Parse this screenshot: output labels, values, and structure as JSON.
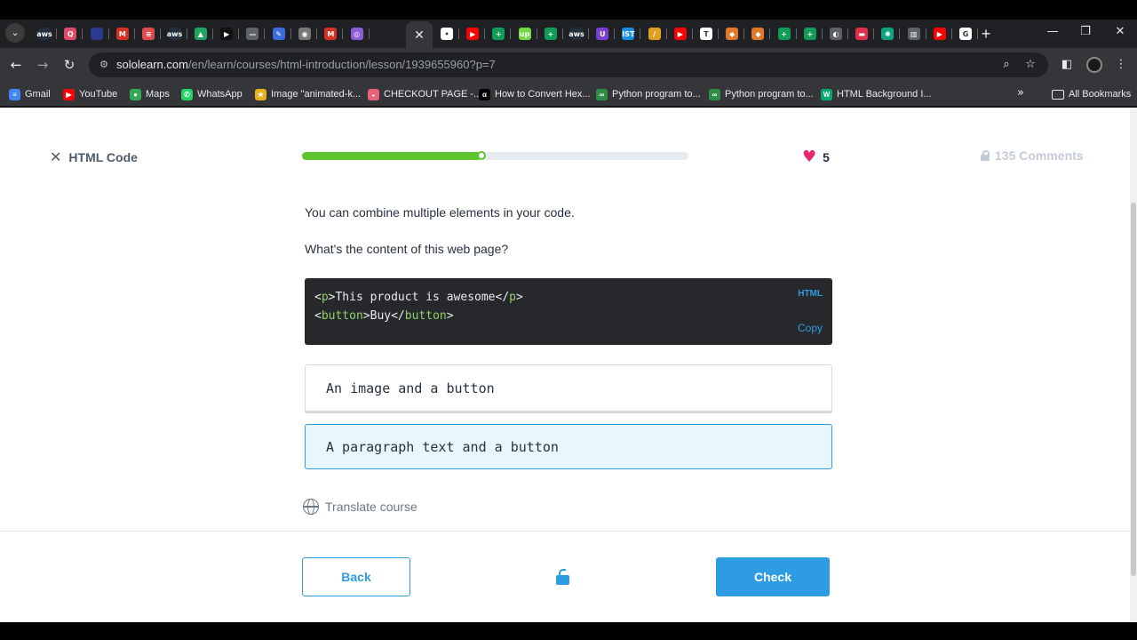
{
  "browser": {
    "url_host": "sololearn.com",
    "url_path": "/en/learn/courses/html-introduction/lesson/1939655960?p=7",
    "tabs": [
      {
        "icon": "aws-icon",
        "color": "#232f3e",
        "glyph": "aws"
      },
      {
        "icon": "q-icon",
        "color": "#e24a6a",
        "glyph": "Q"
      },
      {
        "icon": "window-icon",
        "color": "#2b3a8f",
        "glyph": ""
      },
      {
        "icon": "gmail-icon",
        "color": "#d93025",
        "glyph": "M"
      },
      {
        "icon": "news-icon",
        "color": "#e04b4b",
        "glyph": "≡"
      },
      {
        "icon": "aws-icon",
        "color": "#232f3e",
        "glyph": "aws"
      },
      {
        "icon": "drive-icon",
        "color": "#1fa463",
        "glyph": "▲"
      },
      {
        "icon": "video-icon",
        "color": "#111111",
        "glyph": "▶"
      },
      {
        "icon": "dash-icon",
        "color": "#5f6368",
        "glyph": "—"
      },
      {
        "icon": "pen-icon",
        "color": "#3c6de0",
        "glyph": "✎"
      },
      {
        "icon": "robot-icon",
        "color": "#777777",
        "glyph": "◉"
      },
      {
        "icon": "gmail-icon",
        "color": "#d93025",
        "glyph": "M"
      },
      {
        "icon": "swirl-icon",
        "color": "#8e5bd6",
        "glyph": "◎"
      }
    ],
    "tabs_right": [
      {
        "icon": "line-icon",
        "color": "#ffffff",
        "glyph": "•"
      },
      {
        "icon": "youtube-icon",
        "color": "#ff0000",
        "glyph": "▶"
      },
      {
        "icon": "sheets-icon",
        "color": "#0f9d58",
        "glyph": "+"
      },
      {
        "icon": "upwork-icon",
        "color": "#6fda44",
        "glyph": "up"
      },
      {
        "icon": "sheets-icon",
        "color": "#0f9d58",
        "glyph": "+"
      },
      {
        "icon": "aws-icon",
        "color": "#232f3e",
        "glyph": "aws"
      },
      {
        "icon": "shield-icon",
        "color": "#7a3fd0",
        "glyph": "U"
      },
      {
        "icon": "ist-icon",
        "color": "#1a8fe3",
        "glyph": "IST"
      },
      {
        "icon": "slash-icon",
        "color": "#e0a020",
        "glyph": "/"
      },
      {
        "icon": "youtube-icon",
        "color": "#ff0000",
        "glyph": "▶"
      },
      {
        "icon": "doc-icon",
        "color": "#ffffff",
        "glyph": "T"
      },
      {
        "icon": "pin-icon",
        "color": "#e07a2a",
        "glyph": "◆"
      },
      {
        "icon": "pin-icon",
        "color": "#e07a2a",
        "glyph": "◆"
      },
      {
        "icon": "sheets-icon",
        "color": "#0f9d58",
        "glyph": "+"
      },
      {
        "icon": "sheets-icon",
        "color": "#0f9d58",
        "glyph": "+"
      },
      {
        "icon": "globe-icon",
        "color": "#5f6368",
        "glyph": "◐"
      },
      {
        "icon": "slides-icon",
        "color": "#e0304b",
        "glyph": "▬"
      },
      {
        "icon": "chatgpt-icon",
        "color": "#10a37f",
        "glyph": "✺"
      },
      {
        "icon": "trash-icon",
        "color": "#5f6368",
        "glyph": "▥"
      },
      {
        "icon": "youtube-icon",
        "color": "#ff0000",
        "glyph": "▶"
      },
      {
        "icon": "google-icon",
        "color": "#ffffff",
        "glyph": "G"
      }
    ],
    "bookmarks": [
      {
        "label": "Gmail",
        "icon": "docs-icon",
        "color": "#4285f4",
        "glyph": "≡"
      },
      {
        "label": "YouTube",
        "icon": "youtube-icon",
        "color": "#ff0000",
        "glyph": "▶"
      },
      {
        "label": "Maps",
        "icon": "maps-icon",
        "color": "#34a853",
        "glyph": "●"
      },
      {
        "label": "WhatsApp",
        "icon": "whatsapp-icon",
        "color": "#25d366",
        "glyph": "✆"
      },
      {
        "label": "Image \"animated-k...",
        "icon": "star-icon",
        "color": "#e8b11b",
        "glyph": "★"
      },
      {
        "label": "CHECKOUT PAGE -...",
        "icon": "checkout-icon",
        "color": "#e8637a",
        "glyph": "◒"
      },
      {
        "label": "How to Convert Hex...",
        "icon": "alpha-icon",
        "color": "#000000",
        "glyph": "α"
      },
      {
        "label": "Python program to...",
        "icon": "gfg-icon",
        "color": "#2f8d46",
        "glyph": "∞"
      },
      {
        "label": "Python program to...",
        "icon": "gfg-icon",
        "color": "#2f8d46",
        "glyph": "∞"
      },
      {
        "label": "HTML Background I...",
        "icon": "w3-icon",
        "color": "#04aa6d",
        "glyph": "W"
      }
    ],
    "all_bookmarks": "All Bookmarks"
  },
  "lesson": {
    "title": "HTML Code",
    "progress_fraction": 0.465,
    "hearts": "5",
    "comments": "135 Comments",
    "intro": "You can combine multiple elements in your code.",
    "question": "What's the content of this web page?",
    "code": {
      "language": "HTML",
      "copy_label": "Copy",
      "line1": {
        "open": "<",
        "tag1": "p",
        "gt": ">",
        "text": "This product is awesome",
        "close_open": "</",
        "tag2": "p",
        "close_gt": ">"
      },
      "line2": {
        "open": "<",
        "tag1": "button",
        "gt": ">",
        "text": "Buy",
        "close_open": "</",
        "tag2": "button",
        "close_gt": ">"
      }
    },
    "options": [
      "An image and a button",
      "A paragraph text and a button"
    ],
    "translate": "Translate course",
    "back": "Back",
    "check": "Check"
  },
  "colors": {
    "accent": "#2d9ce2",
    "progress": "#5fc52e",
    "heart": "#e5276e",
    "selected_bg": "#e9f6fd"
  }
}
